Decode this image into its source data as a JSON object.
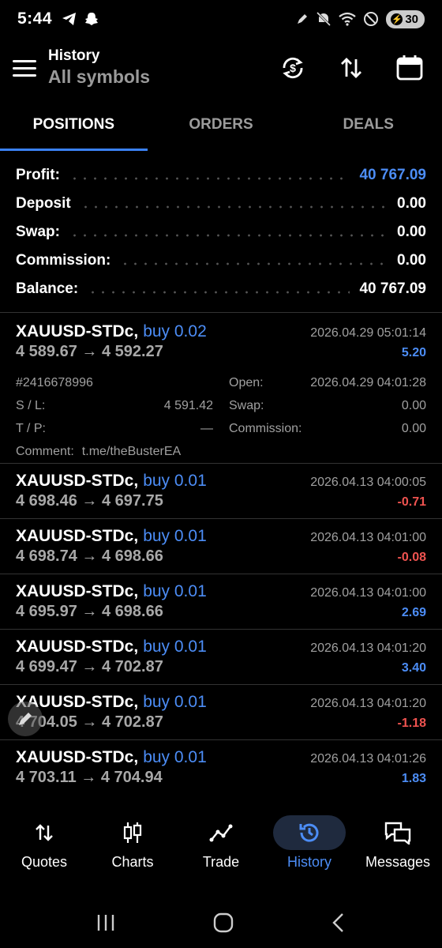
{
  "status": {
    "time": "5:44",
    "battery": "30"
  },
  "header": {
    "title": "History",
    "subtitle": "All symbols"
  },
  "tabs": [
    {
      "label": "POSITIONS",
      "active": true
    },
    {
      "label": "ORDERS",
      "active": false
    },
    {
      "label": "DEALS",
      "active": false
    }
  ],
  "summary": {
    "profit_label": "Profit:",
    "profit": "40 767.09",
    "deposit_label": "Deposit",
    "deposit": "0.00",
    "swap_label": "Swap:",
    "swap": "0.00",
    "commission_label": "Commission:",
    "commission": "0.00",
    "balance_label": "Balance:",
    "balance": "40 767.09"
  },
  "deals": [
    {
      "symbol": "XAUUSD-STDc,",
      "side": "buy 0.02",
      "time": "2026.04.29 05:01:14",
      "prices": "4 589.67 → 4 592.27",
      "profit": "5.20",
      "profit_color": "#4c8df6",
      "details": {
        "ticket": "#2416678996",
        "sl_label": "S / L:",
        "sl": "4 591.42",
        "tp_label": "T / P:",
        "tp": "—",
        "open_label": "Open:",
        "open": "2026.04.29 04:01:28",
        "swap_label": "Swap:",
        "swap": "0.00",
        "commission_label": "Commission:",
        "commission": "0.00",
        "comment_label": "Comment:",
        "comment": "t.me/theBusterEA"
      }
    },
    {
      "symbol": "XAUUSD-STDc,",
      "side": "buy 0.01",
      "time": "2026.04.13 04:00:05",
      "prices": "4 698.46 → 4 697.75",
      "profit": "-0.71",
      "profit_color": "#ef5350"
    },
    {
      "symbol": "XAUUSD-STDc,",
      "side": "buy 0.01",
      "time": "2026.04.13 04:01:00",
      "prices": "4 698.74 → 4 698.66",
      "profit": "-0.08",
      "profit_color": "#ef5350"
    },
    {
      "symbol": "XAUUSD-STDc,",
      "side": "buy 0.01",
      "time": "2026.04.13 04:01:00",
      "prices": "4 695.97 → 4 698.66",
      "profit": "2.69",
      "profit_color": "#4c8df6"
    },
    {
      "symbol": "XAUUSD-STDc,",
      "side": "buy 0.01",
      "time": "2026.04.13 04:01:20",
      "prices": "4 699.47 → 4 702.87",
      "profit": "3.40",
      "profit_color": "#4c8df6"
    },
    {
      "symbol": "XAUUSD-STDc,",
      "side": "buy 0.01",
      "time": "2026.04.13 04:01:20",
      "prices": "4 704.05 → 4 702.87",
      "profit": "-1.18",
      "profit_color": "#ef5350"
    },
    {
      "symbol": "XAUUSD-STDc,",
      "side": "buy 0.01",
      "time": "2026.04.13 04:01:26",
      "prices": "4 703.11 → 4 704.94",
      "profit": "1.83",
      "profit_color": "#4c8df6"
    }
  ],
  "nav": [
    {
      "label": "Quotes",
      "icon": "quotes-icon"
    },
    {
      "label": "Charts",
      "icon": "charts-icon"
    },
    {
      "label": "Trade",
      "icon": "trade-icon"
    },
    {
      "label": "History",
      "icon": "history-icon",
      "active": true
    },
    {
      "label": "Messages",
      "icon": "messages-icon"
    }
  ]
}
